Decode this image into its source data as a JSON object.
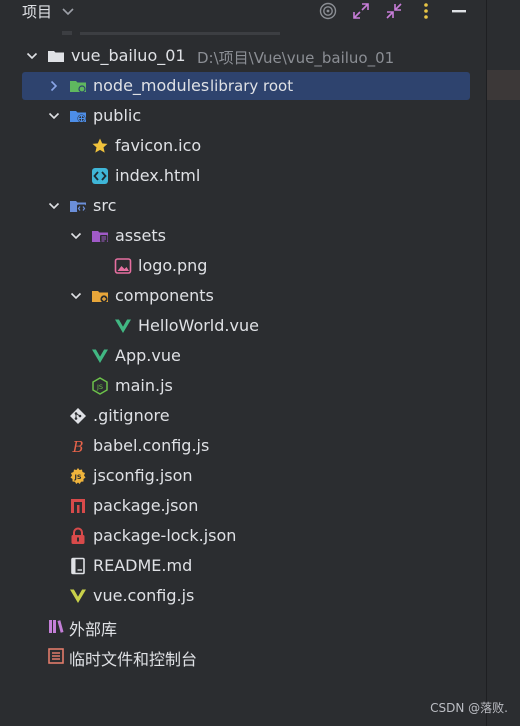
{
  "header": {
    "title": "项目",
    "icons": [
      "target-icon",
      "expand-all-icon",
      "collapse-all-icon",
      "more-options-icon",
      "minimize-icon"
    ]
  },
  "tree": {
    "root": {
      "label": "vue_bailuo_01",
      "path": "D:\\项目\\Vue\\vue_bailuo_01"
    },
    "node_modules": {
      "label": "node_modules",
      "hint": "library root"
    },
    "public": {
      "label": "public",
      "children": [
        "favicon.ico",
        "index.html"
      ]
    },
    "src": {
      "label": "src"
    },
    "assets": {
      "label": "assets"
    },
    "logo": {
      "label": "logo.png"
    },
    "components": {
      "label": "components"
    },
    "helloworld": {
      "label": "HelloWorld.vue"
    },
    "app": {
      "label": "App.vue"
    },
    "main": {
      "label": "main.js"
    },
    "gitignore": {
      "label": ".gitignore"
    },
    "babel": {
      "label": "babel.config.js"
    },
    "jsconfig": {
      "label": "jsconfig.json"
    },
    "package": {
      "label": "package.json"
    },
    "packagelock": {
      "label": "package-lock.json"
    },
    "readme": {
      "label": "README.md"
    },
    "vueconfig": {
      "label": "vue.config.js"
    },
    "external": {
      "label": "外部库"
    },
    "scratches": {
      "label": "临时文件和控制台"
    }
  },
  "colors": {
    "background": "#2b2d30",
    "selection": "#2e436e",
    "text": "#dfe1e5",
    "hint": "#8b8e94"
  },
  "watermark": "CSDN @落败."
}
